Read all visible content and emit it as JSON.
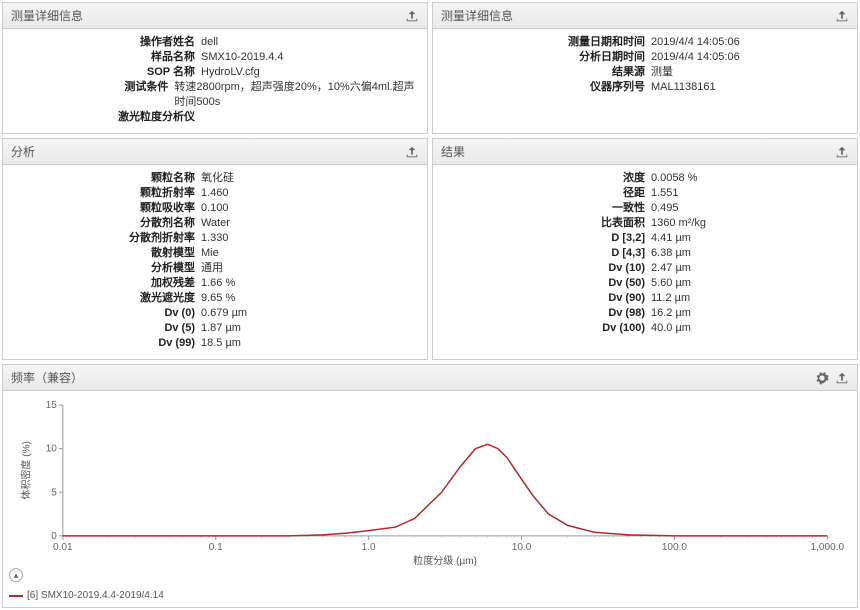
{
  "panels": {
    "topLeft": {
      "title": "测量详细信息",
      "rows": [
        {
          "label": "操作者姓名",
          "value": "dell"
        },
        {
          "label": "样品名称",
          "value": "SMX10-2019.4.4"
        },
        {
          "label": "SOP 名称",
          "value": "HydroLV.cfg"
        },
        {
          "label": "测试条件",
          "value": "转速2800rpm，超声强度20%，10%六偏4ml.超声时间500s"
        },
        {
          "label": "激光粒度分析仪",
          "value": ""
        }
      ]
    },
    "topRight": {
      "title": "测量详细信息",
      "rows": [
        {
          "label": "测量日期和时间",
          "value": "2019/4/4 14:05:06"
        },
        {
          "label": "分析日期时间",
          "value": "2019/4/4 14:05:06"
        },
        {
          "label": "结果源",
          "value": "测量"
        },
        {
          "label": "仪器序列号",
          "value": "MAL1138161"
        }
      ]
    },
    "midLeft": {
      "title": "分析",
      "rows": [
        {
          "label": "颗粒名称",
          "value": "氧化硅"
        },
        {
          "label": "颗粒折射率",
          "value": "1.460"
        },
        {
          "label": "颗粒吸收率",
          "value": "0.100"
        },
        {
          "label": "分散剂名称",
          "value": "Water"
        },
        {
          "label": "分散剂折射率",
          "value": "1.330"
        },
        {
          "label": "散射模型",
          "value": "Mie"
        },
        {
          "label": "分析模型",
          "value": "通用"
        },
        {
          "label": "加权残差",
          "value": "1.66 %"
        },
        {
          "label": "激光遮光度",
          "value": "9.65 %"
        },
        {
          "label": "Dv (0)",
          "value": "0.679 µm"
        },
        {
          "label": "Dv (5)",
          "value": "1.87 µm"
        },
        {
          "label": "Dv (99)",
          "value": "18.5 µm"
        }
      ]
    },
    "midRight": {
      "title": "结果",
      "rows": [
        {
          "label": "浓度",
          "value": "0.0058 %"
        },
        {
          "label": "径距",
          "value": "1.551"
        },
        {
          "label": "一致性",
          "value": "0.495"
        },
        {
          "label": "比表面积",
          "value": "1360 m²/kg"
        },
        {
          "label": "D [3,2]",
          "value": "4.41 µm"
        },
        {
          "label": "D [4,3]",
          "value": "6.38 µm"
        },
        {
          "label": "Dv (10)",
          "value": "2.47 µm"
        },
        {
          "label": "Dv (50)",
          "value": "5.60 µm"
        },
        {
          "label": "Dv (90)",
          "value": "11.2 µm"
        },
        {
          "label": "Dv (98)",
          "value": "16.2 µm"
        },
        {
          "label": "Dv (100)",
          "value": "40.0 µm"
        }
      ]
    },
    "chart": {
      "title": "频率（兼容）",
      "ylabel": "体积密度 (%)",
      "xlabel": "粒度分级 (µm)"
    }
  },
  "legend": {
    "item": "[6] SMX10-2019.4.4-2019/4.14"
  },
  "chart_data": {
    "type": "line",
    "title": "频率（兼容）",
    "xlabel": "粒度分级 (µm)",
    "ylabel": "体积密度 (%)",
    "xscale": "log",
    "xlim": [
      0.01,
      1000
    ],
    "ylim": [
      0,
      15
    ],
    "xticks": [
      0.01,
      0.1,
      1.0,
      10.0,
      100.0,
      1000.0
    ],
    "yticks": [
      0,
      5,
      10,
      15
    ],
    "series": [
      {
        "name": "[6] SMX10-2019.4.4-2019/4.14",
        "color": "#b02a2a",
        "x": [
          0.01,
          0.1,
          0.3,
          0.5,
          0.7,
          1.0,
          1.5,
          2.0,
          3.0,
          4.0,
          5.0,
          6.0,
          7.0,
          8.0,
          10.0,
          12.0,
          15.0,
          20.0,
          30.0,
          50.0,
          100.0,
          1000.0
        ],
        "y": [
          0,
          0,
          0,
          0.1,
          0.3,
          0.6,
          1.0,
          2.0,
          5.0,
          8.0,
          10.0,
          10.5,
          10.0,
          9.0,
          6.5,
          4.5,
          2.5,
          1.2,
          0.4,
          0.1,
          0,
          0
        ]
      }
    ]
  }
}
